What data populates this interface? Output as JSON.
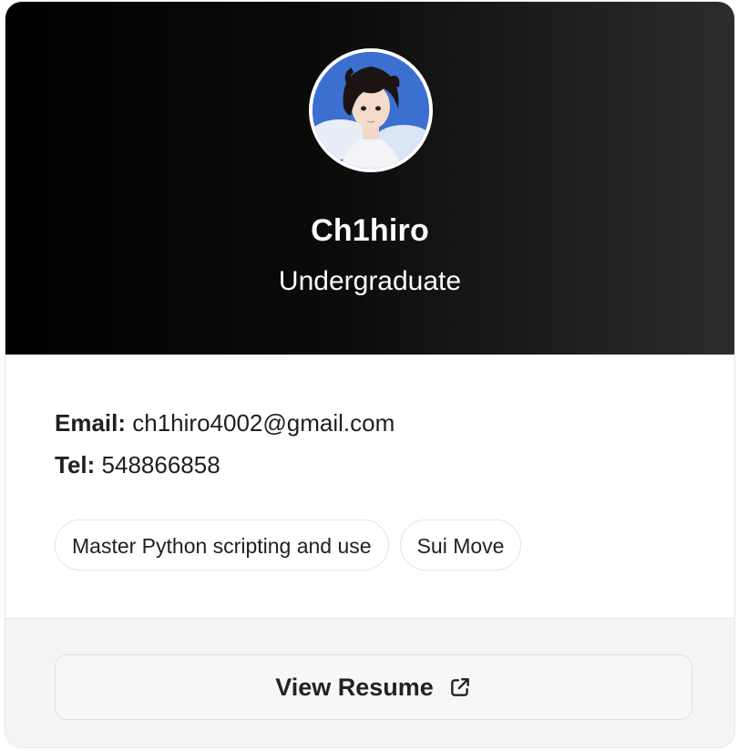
{
  "profile": {
    "name": "Ch1hiro",
    "role": "Undergraduate"
  },
  "contact": {
    "email_label": "Email:",
    "email": "ch1hiro4002@gmail.com",
    "tel_label": "Tel:",
    "tel": "548866858"
  },
  "skills": [
    "Master Python scripting and use",
    "Sui Move"
  ],
  "action": {
    "resume_label": "View Resume",
    "icon": "external-link-icon"
  },
  "colors": {
    "header_dark": "#000000",
    "header_light": "#2c2c2c",
    "avatar_bg": "#3b6fd0",
    "footer_bg": "#f4f4f4"
  }
}
